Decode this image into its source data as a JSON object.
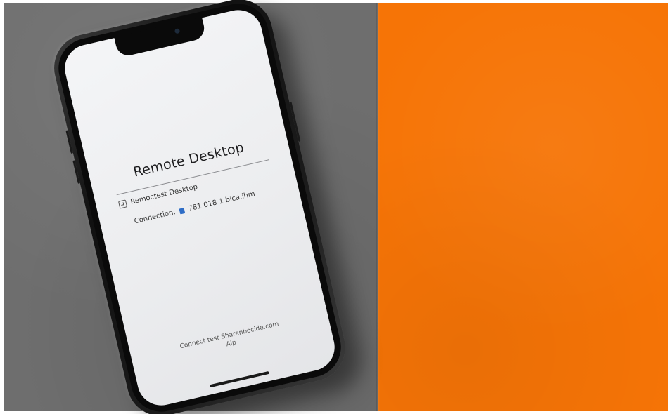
{
  "phone_screen": {
    "title": "Remote Desktop",
    "app_row_label": "Remoctest Desktop",
    "connection_label": "Connection:",
    "connection_value": "781 018 1 bica.ihm",
    "footer_line1": "Connect test Sharenbocide.com",
    "footer_line2": "Alp"
  },
  "colors": {
    "left_background": "#6e6e6e",
    "right_background": "#f67406",
    "phone_body": "#111111",
    "screen": "#f0f1f3",
    "connection_icon": "#2f6dc6"
  },
  "icons": {
    "app_icon": "desktop-icon",
    "connection_icon": "connection-icon"
  }
}
